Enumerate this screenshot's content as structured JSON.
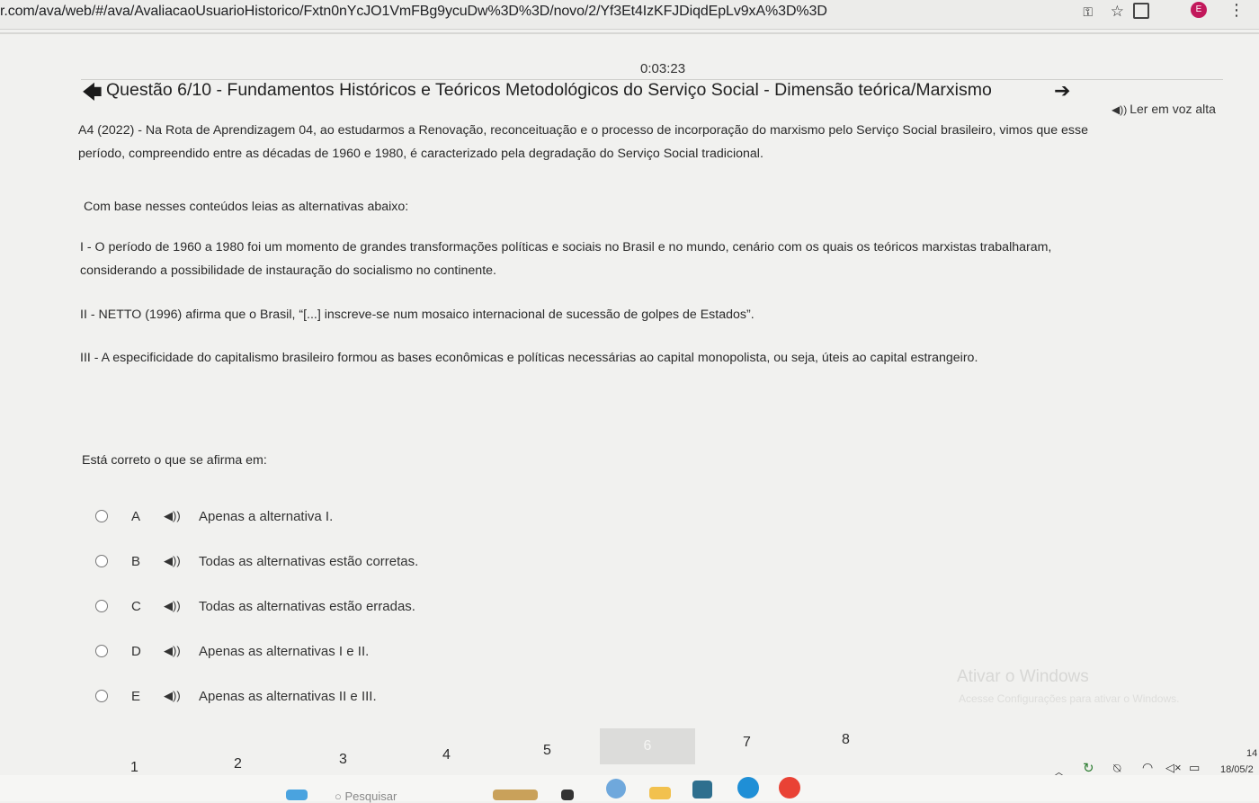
{
  "browser": {
    "url": "r.com/ava/web/#/ava/AvaliacaoUsuarioHistorico/Fxtn0nYcJO1VmFBg9ycuDw%3D%3D/novo/2/Yf3Et4IzKFJDiqdEpLv9xA%3D%3D",
    "profile_initial": "E",
    "icons": [
      "key-icon",
      "star-icon",
      "extension-icon",
      "profile-icon",
      "menu-icon"
    ]
  },
  "timer": "0:03:23",
  "question": {
    "title": "Questão 6/10 - Fundamentos Históricos e Teóricos Metodológicos do Serviço Social - Dimensão teórica/Marxismo",
    "read_aloud": "Ler em voz alta",
    "intro_line1": "A4 (2022) - Na Rota de Aprendizagem 04, ao estudarmos a Renovação, reconceituação e o processo de incorporação do marxismo pelo Serviço Social brasileiro, vimos que esse",
    "intro_line2": "período, compreendido entre as décadas de 1960 e 1980, é caracterizado pela degradação do Serviço Social tradicional.",
    "base": "Com base nesses conteúdos leias as alternativas abaixo:",
    "item1_line1": "I - O período de 1960 a 1980 foi um momento de grandes transformações políticas e sociais no Brasil e no mundo, cenário com os quais os teóricos marxistas trabalharam,",
    "item1_line2": "considerando a possibilidade de instauração do socialismo no continente.",
    "item2": "II - NETTO (1996) afirma que o Brasil, “[...] inscreve-se num mosaico internacional de sucessão de golpes de Estados”.",
    "item3": "III - A especificidade do capitalismo brasileiro formou as bases econômicas e políticas necessárias ao capital monopolista, ou seja, úteis ao capital estrangeiro.",
    "prompt": "Está correto o que se afirma em:"
  },
  "options": [
    {
      "letter": "A",
      "text": "Apenas a alternativa I."
    },
    {
      "letter": "B",
      "text": "Todas as alternativas estão corretas."
    },
    {
      "letter": "C",
      "text": "Todas as alternativas estão erradas."
    },
    {
      "letter": "D",
      "text": "Apenas as alternativas I e II."
    },
    {
      "letter": "E",
      "text": "Apenas as alternativas II e III."
    }
  ],
  "pager": {
    "pages": [
      "1",
      "2",
      "3",
      "4",
      "5",
      "6",
      "7",
      "8"
    ],
    "active": "6"
  },
  "watermark": {
    "title": "Ativar o Windows",
    "subtitle": "Acesse Configurações para ativar o Windows."
  },
  "taskbar": {
    "search_placeholder": "Pesquisar",
    "date": "18/05/2",
    "time": "14"
  }
}
